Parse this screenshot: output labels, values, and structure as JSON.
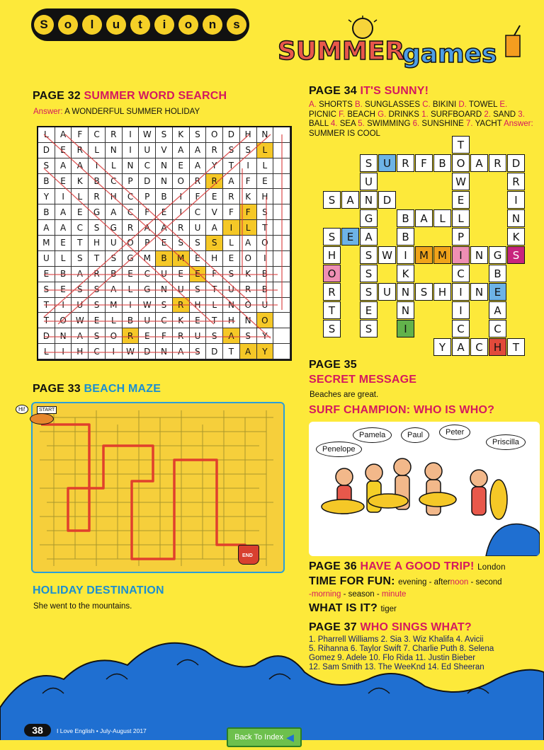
{
  "header": {
    "section": "Solutions",
    "logo": "SUMMER GAMES"
  },
  "p32": {
    "page": "PAGE 32",
    "title": "SUMMER WORD SEARCH",
    "answer_label": "Answer:",
    "answer": "A WONDERFUL SUMMER HOLIDAY",
    "grid": [
      "LAFCRIWSKSODHN",
      "DERLNIUVAARSSL",
      "SAAILNCNEAYTIL",
      "BEKBCPDNORRAFE",
      "YILRHCPBIFERKH",
      "BAEGACFEICVFFS",
      "AACSGRAARUAILT",
      "METHUOPESSSLAO",
      "ULSTSGMBMEHEOI",
      "EBARBECUEEFSKB",
      "SESSALGNUSTURB",
      "TIUSMIWSRHLNOU",
      "TOWELBUCKETHNO",
      "DNASOREFRUSASY",
      "LIHCIWDNASDTAY"
    ]
  },
  "p33": {
    "page": "PAGE 33",
    "title": "BEACH MAZE",
    "start": "START",
    "end": "END",
    "exit": "Hi!"
  },
  "holiday": {
    "title": "HOLIDAY DESTINATION",
    "text": "She went to the mountains."
  },
  "p34": {
    "page": "PAGE 34",
    "title": "IT'S SUNNY!",
    "answers": [
      {
        "k": "A.",
        "v": "SHORTS"
      },
      {
        "k": "B.",
        "v": "SUNGLASSES"
      },
      {
        "k": "C.",
        "v": "BIKINI"
      },
      {
        "k": "D.",
        "v": "TOWEL"
      },
      {
        "k": "E.",
        "v": "PICNIC"
      },
      {
        "k": "F.",
        "v": "BEACH"
      },
      {
        "k": "G.",
        "v": "DRINKS"
      },
      {
        "k": "1.",
        "v": "SURFBOARD"
      },
      {
        "k": "2.",
        "v": "SAND"
      },
      {
        "k": "3.",
        "v": "BALL"
      },
      {
        "k": "4.",
        "v": "SEA"
      },
      {
        "k": "5.",
        "v": "SWIMMING"
      },
      {
        "k": "6.",
        "v": "SUNSHINE"
      },
      {
        "k": "7.",
        "v": "YACHT"
      }
    ],
    "answer_label": "Answer:",
    "answer": "SUMMER IS COOL"
  },
  "p35": {
    "page": "PAGE 35",
    "secret_title": "SECRET MESSAGE",
    "secret_text": "Beaches are great.",
    "surf_title": "SURF CHAMPION: WHO IS WHO?",
    "names": [
      "Penelope",
      "Pamela",
      "Paul",
      "Peter",
      "Priscilla"
    ]
  },
  "p36": {
    "page": "PAGE 36",
    "title": "HAVE A GOOD TRIP!",
    "trip_answer": "London",
    "fun_title": "TIME FOR FUN:",
    "fun_parts": [
      {
        "t": "evening - after",
        "c": "n"
      },
      {
        "t": "noon",
        "c": "r"
      },
      {
        "t": " - second",
        "c": "n"
      }
    ],
    "fun_parts2": [
      {
        "t": "-morning",
        "c": "r"
      },
      {
        "t": " - season - ",
        "c": "n"
      },
      {
        "t": "minute",
        "c": "r"
      }
    ],
    "what_title": "WHAT IS IT?",
    "what_answer": "tiger"
  },
  "p37": {
    "page": "PAGE 37",
    "title": "WHO SINGS WHAT?",
    "lines": [
      "1. Pharrell Williams 2. Sia 3. Wiz Khalifa 4. Avicii",
      "5. Rihanna 6. Taylor Swift 7. Charlie Puth 8. Selena",
      "Gomez 9. Adele 10. Flo Rida 11. Justin Bieber",
      "12. Sam Smith 13. The WeeKnd 14. Ed Sheeran"
    ]
  },
  "footer": {
    "page_num": "38",
    "magazine": "I Love English • July-August 2017",
    "back_button": "Back To Index"
  },
  "colors": {
    "bg": "#fde93a",
    "title_pink": "#d4195f",
    "title_blue": "#1b8fd1",
    "wave_blue": "#1f6fd1"
  }
}
